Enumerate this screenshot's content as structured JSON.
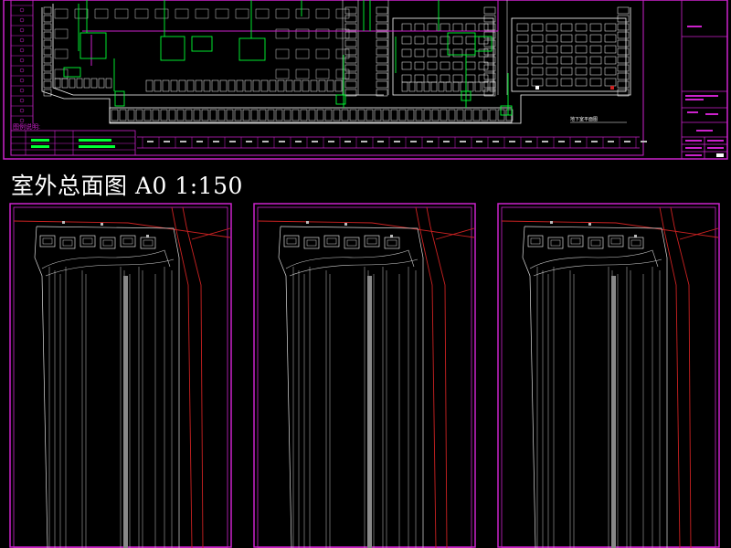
{
  "drawing_title": "室外总面图 A0 1:150",
  "legend_heading": "图例说明:",
  "plan_caption": "地下室平面图",
  "colors": {
    "background": "#000000",
    "frame": "#cc22cc",
    "grid_lines": "#c8c8c8",
    "structure": "#ffffff",
    "equipment": "#00ff33",
    "road_red": "#cc2222",
    "column": "#888888"
  }
}
